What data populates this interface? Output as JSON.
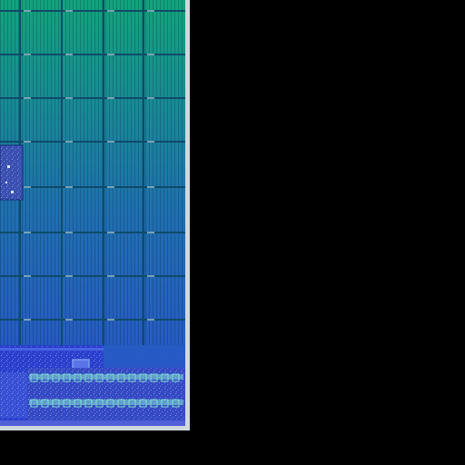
{
  "image": {
    "subject": "die-photo",
    "regions": [
      "memory-array",
      "logic-block",
      "io-strip",
      "blank-background"
    ]
  },
  "colors": {
    "background": "#000000",
    "die_top": "#12a37c",
    "die_mid": "#1f6fb0",
    "die_bottom": "#2b4fcf",
    "grid_line": "#0e4b6a",
    "logic_fill": "#2a3fcc",
    "logic_detail": "#8fb6ff",
    "io_strip": "#3549c4",
    "io_detail": "#7fe0d2",
    "edge_ring": "#cfd8dc"
  }
}
